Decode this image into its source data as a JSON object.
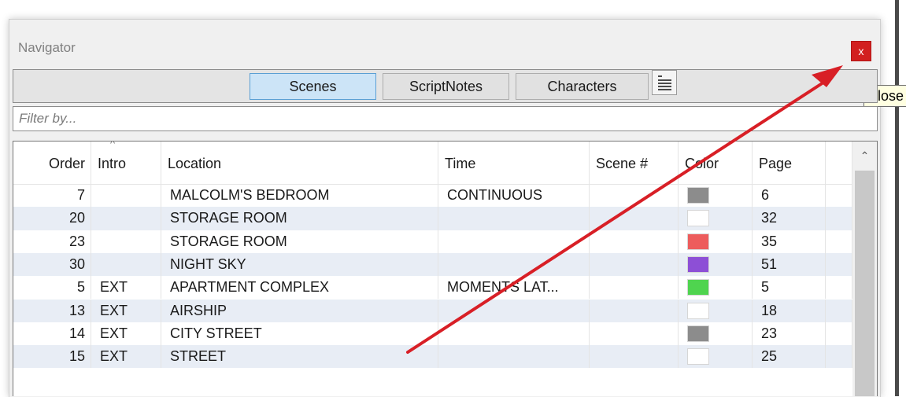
{
  "window": {
    "title": "Navigator",
    "close_label": "x",
    "tooltip": "Close"
  },
  "tabs": [
    {
      "label": "Scenes",
      "active": true
    },
    {
      "label": "ScriptNotes",
      "active": false
    },
    {
      "label": "Characters",
      "active": false
    }
  ],
  "filter": {
    "placeholder": "Filter by..."
  },
  "grid": {
    "sort_indicator": "^",
    "columns": [
      "Order",
      "Intro",
      "Location",
      "Time",
      "Scene #",
      "Color",
      "Page"
    ],
    "rows": [
      {
        "order": "7",
        "intro": "",
        "location": "MALCOLM'S BEDROOM",
        "time": "CONTINUOUS",
        "scene": "",
        "color": "#8c8c8c",
        "page": "6"
      },
      {
        "order": "20",
        "intro": "",
        "location": "STORAGE ROOM",
        "time": "",
        "scene": "",
        "color": "#ffffff",
        "page": "32"
      },
      {
        "order": "23",
        "intro": "",
        "location": "STORAGE ROOM",
        "time": "",
        "scene": "",
        "color": "#ed5c5c",
        "page": "35"
      },
      {
        "order": "30",
        "intro": "",
        "location": "NIGHT SKY",
        "time": "",
        "scene": "",
        "color": "#8d4fd6",
        "page": "51"
      },
      {
        "order": "5",
        "intro": "EXT",
        "location": "APARTMENT COMPLEX",
        "time": "MOMENTS LAT...",
        "scene": "",
        "color": "#4fd44f",
        "page": "5"
      },
      {
        "order": "13",
        "intro": "EXT",
        "location": "AIRSHIP",
        "time": "",
        "scene": "",
        "color": "#ffffff",
        "page": "18"
      },
      {
        "order": "14",
        "intro": "EXT",
        "location": "CITY STREET",
        "time": "",
        "scene": "",
        "color": "#8c8c8c",
        "page": "23"
      },
      {
        "order": "15",
        "intro": "EXT",
        "location": "STREET",
        "time": "",
        "scene": "",
        "color": "#ffffff",
        "page": "25"
      }
    ]
  },
  "colors": {
    "annotation_arrow": "#d81f26",
    "active_tab": "#cce4f7",
    "row_alt": "#e8edf5",
    "close_button": "#d21f1f"
  },
  "icons": {
    "close": "close-icon",
    "list_view": "list-view-icon",
    "scroll_up": "chevron-up-icon",
    "sort": "sort-ascending-icon"
  }
}
